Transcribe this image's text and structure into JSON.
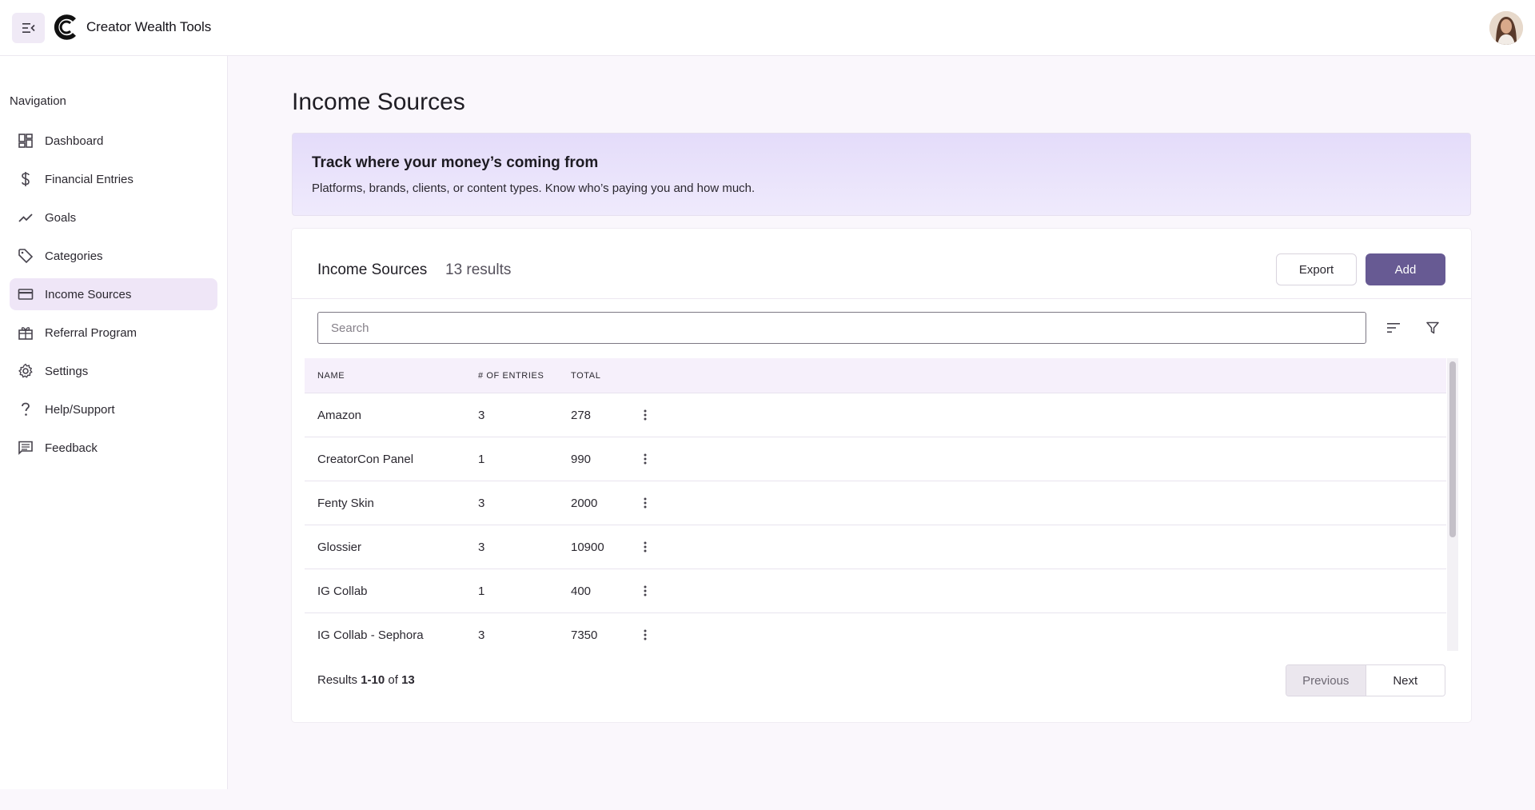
{
  "app": {
    "brand": "Creator Wealth Tools"
  },
  "sidebar": {
    "title": "Navigation",
    "items": [
      {
        "label": "Dashboard",
        "icon": "dashboard-icon"
      },
      {
        "label": "Financial Entries",
        "icon": "dollar-icon"
      },
      {
        "label": "Goals",
        "icon": "trending-icon"
      },
      {
        "label": "Categories",
        "icon": "tag-icon"
      },
      {
        "label": "Income Sources",
        "icon": "card-icon",
        "active": true
      },
      {
        "label": "Referral Program",
        "icon": "gift-icon"
      },
      {
        "label": "Settings",
        "icon": "gear-icon"
      },
      {
        "label": "Help/Support",
        "icon": "question-icon"
      },
      {
        "label": "Feedback",
        "icon": "feedback-icon"
      }
    ]
  },
  "page": {
    "title": "Income Sources"
  },
  "banner": {
    "title": "Track where your money’s coming from",
    "subtitle": "Platforms, brands, clients, or content types. Know who’s paying you and how much."
  },
  "card": {
    "title": "Income Sources",
    "count": "13 results",
    "export_label": "Export",
    "add_label": "Add",
    "search_placeholder": "Search",
    "columns": [
      "NAME",
      "# OF ENTRIES",
      "TOTAL"
    ],
    "rows": [
      {
        "name": "Amazon",
        "entries": "3",
        "total": "278"
      },
      {
        "name": "CreatorCon Panel",
        "entries": "1",
        "total": "990"
      },
      {
        "name": "Fenty Skin",
        "entries": "3",
        "total": "2000"
      },
      {
        "name": "Glossier",
        "entries": "3",
        "total": "10900"
      },
      {
        "name": "IG Collab",
        "entries": "1",
        "total": "400"
      },
      {
        "name": "IG Collab - Sephora",
        "entries": "3",
        "total": "7350"
      },
      {
        "name": "",
        "entries": "",
        "total": ""
      }
    ],
    "results_prefix": "Results ",
    "results_range": "1-10",
    "results_of": " of ",
    "results_total": "13",
    "prev_label": "Previous",
    "next_label": "Next"
  },
  "colors": {
    "accent": "#675a93",
    "active_nav": "#efe6f7",
    "banner": "#e4dcfa"
  }
}
